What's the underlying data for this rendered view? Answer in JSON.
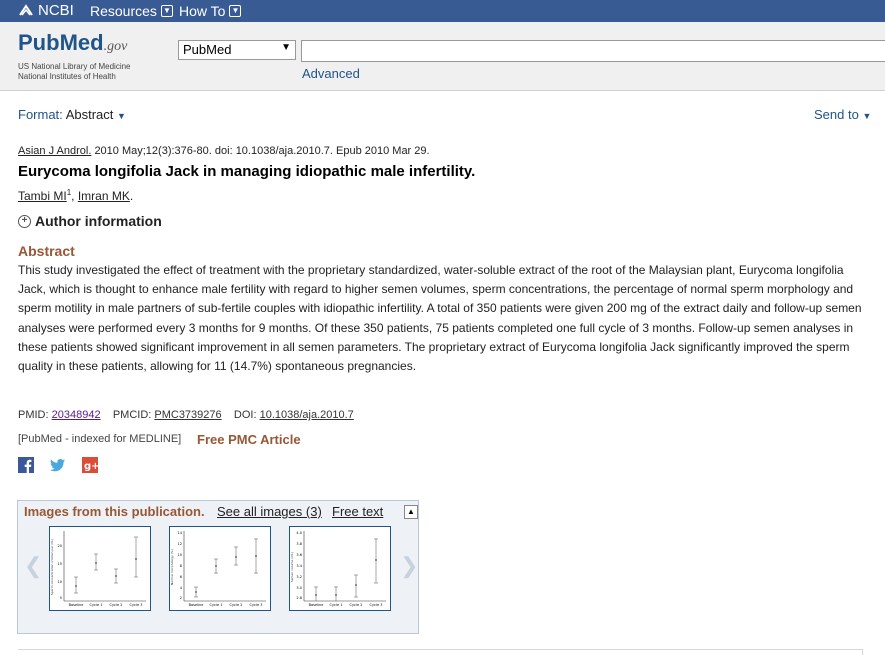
{
  "topbar": {
    "ncbi_label": "NCBI",
    "menu": [
      {
        "label": "Resources"
      },
      {
        "label": "How To"
      }
    ]
  },
  "header": {
    "logo_pub": "Pub",
    "logo_med": "Med",
    "logo_gov": ".gov",
    "sub_line1": "US National Library of Medicine",
    "sub_line2": "National Institutes of Health",
    "db_selected": "PubMed",
    "search_value": "",
    "advanced_label": "Advanced"
  },
  "format": {
    "label": "Format",
    "value": "Abstract",
    "send_to": "Send to"
  },
  "article": {
    "journal": "Asian J Androl.",
    "citation_rest": "2010 May;12(3):376-80. doi: 10.1038/aja.2010.7. Epub 2010 Mar 29.",
    "title": "Eurycoma longifolia Jack in managing idiopathic male infertility.",
    "author1": "Tambi MI",
    "author1_sup": "1",
    "author_sep": ", ",
    "author2": "Imran MK",
    "author_end": ".",
    "author_info_label": "Author information",
    "abstract_heading": "Abstract",
    "abstract_text": "This study investigated the effect of treatment with the proprietary standardized, water-soluble extract of the root of the Malaysian plant, Eurycoma longifolia Jack, which is thought to enhance male fertility with regard to higher semen volumes, sperm concentrations, the percentage of normal sperm morphology and sperm motility in male partners of sub-fertile couples with idiopathic infertility. A total of 350 patients were given 200 mg of the extract daily and follow-up semen analyses were performed every 3 months for 9 months. Of these 350 patients, 75 patients completed one full cycle of 3 months. Follow-up semen analyses in these patients showed significant improvement in all semen parameters. The proprietary extract of Eurycoma longifolia Jack significantly improved the sperm quality in these patients, allowing for 11 (14.7%) spontaneous pregnancies.",
    "pmid_label": "PMID:",
    "pmid": "20348942",
    "pmcid_label": "PMCID:",
    "pmcid": "PMC3739276",
    "doi_label": "DOI:",
    "doi": "10.1038/aja.2010.7",
    "indexed": "[PubMed - indexed for MEDLINE]",
    "free_pmc": "Free PMC Article"
  },
  "social": [
    {
      "icon": "facebook-icon",
      "color": "#3b5998"
    },
    {
      "icon": "twitter-icon",
      "color": "#4aa8e0"
    },
    {
      "icon": "google-plus-icon",
      "color": "#dd4b39"
    }
  ],
  "images_panel": {
    "title": "Images from this publication.",
    "see_all": "See all images (3)",
    "free_text": "Free text",
    "thumbs": [
      {
        "ylabel": "Sperm concentration (million per mL)",
        "yticks": [
          "20",
          "15",
          "10",
          "5"
        ],
        "xticks": [
          "Baseline",
          "Cycle 1",
          "Cycle 2",
          "Cycle 3"
        ]
      },
      {
        "ylabel": "Normal morphology (%)",
        "yticks": [
          "14",
          "12",
          "10",
          "8",
          "6",
          "4",
          "2"
        ],
        "xticks": [
          "Baseline",
          "Cycle 1",
          "Cycle 2",
          "Cycle 3"
        ]
      },
      {
        "ylabel": "Semen volume (mL)",
        "yticks": [
          "4.0",
          "3.8",
          "3.6",
          "3.4",
          "3.2",
          "3.0",
          "2.8"
        ],
        "xticks": [
          "Baseline",
          "Cycle 1",
          "Cycle 2",
          "Cycle 3"
        ]
      }
    ]
  },
  "colors": {
    "ncbi_blue": "#395b94",
    "link_blue": "#20558a",
    "accent_brown": "#985735"
  }
}
